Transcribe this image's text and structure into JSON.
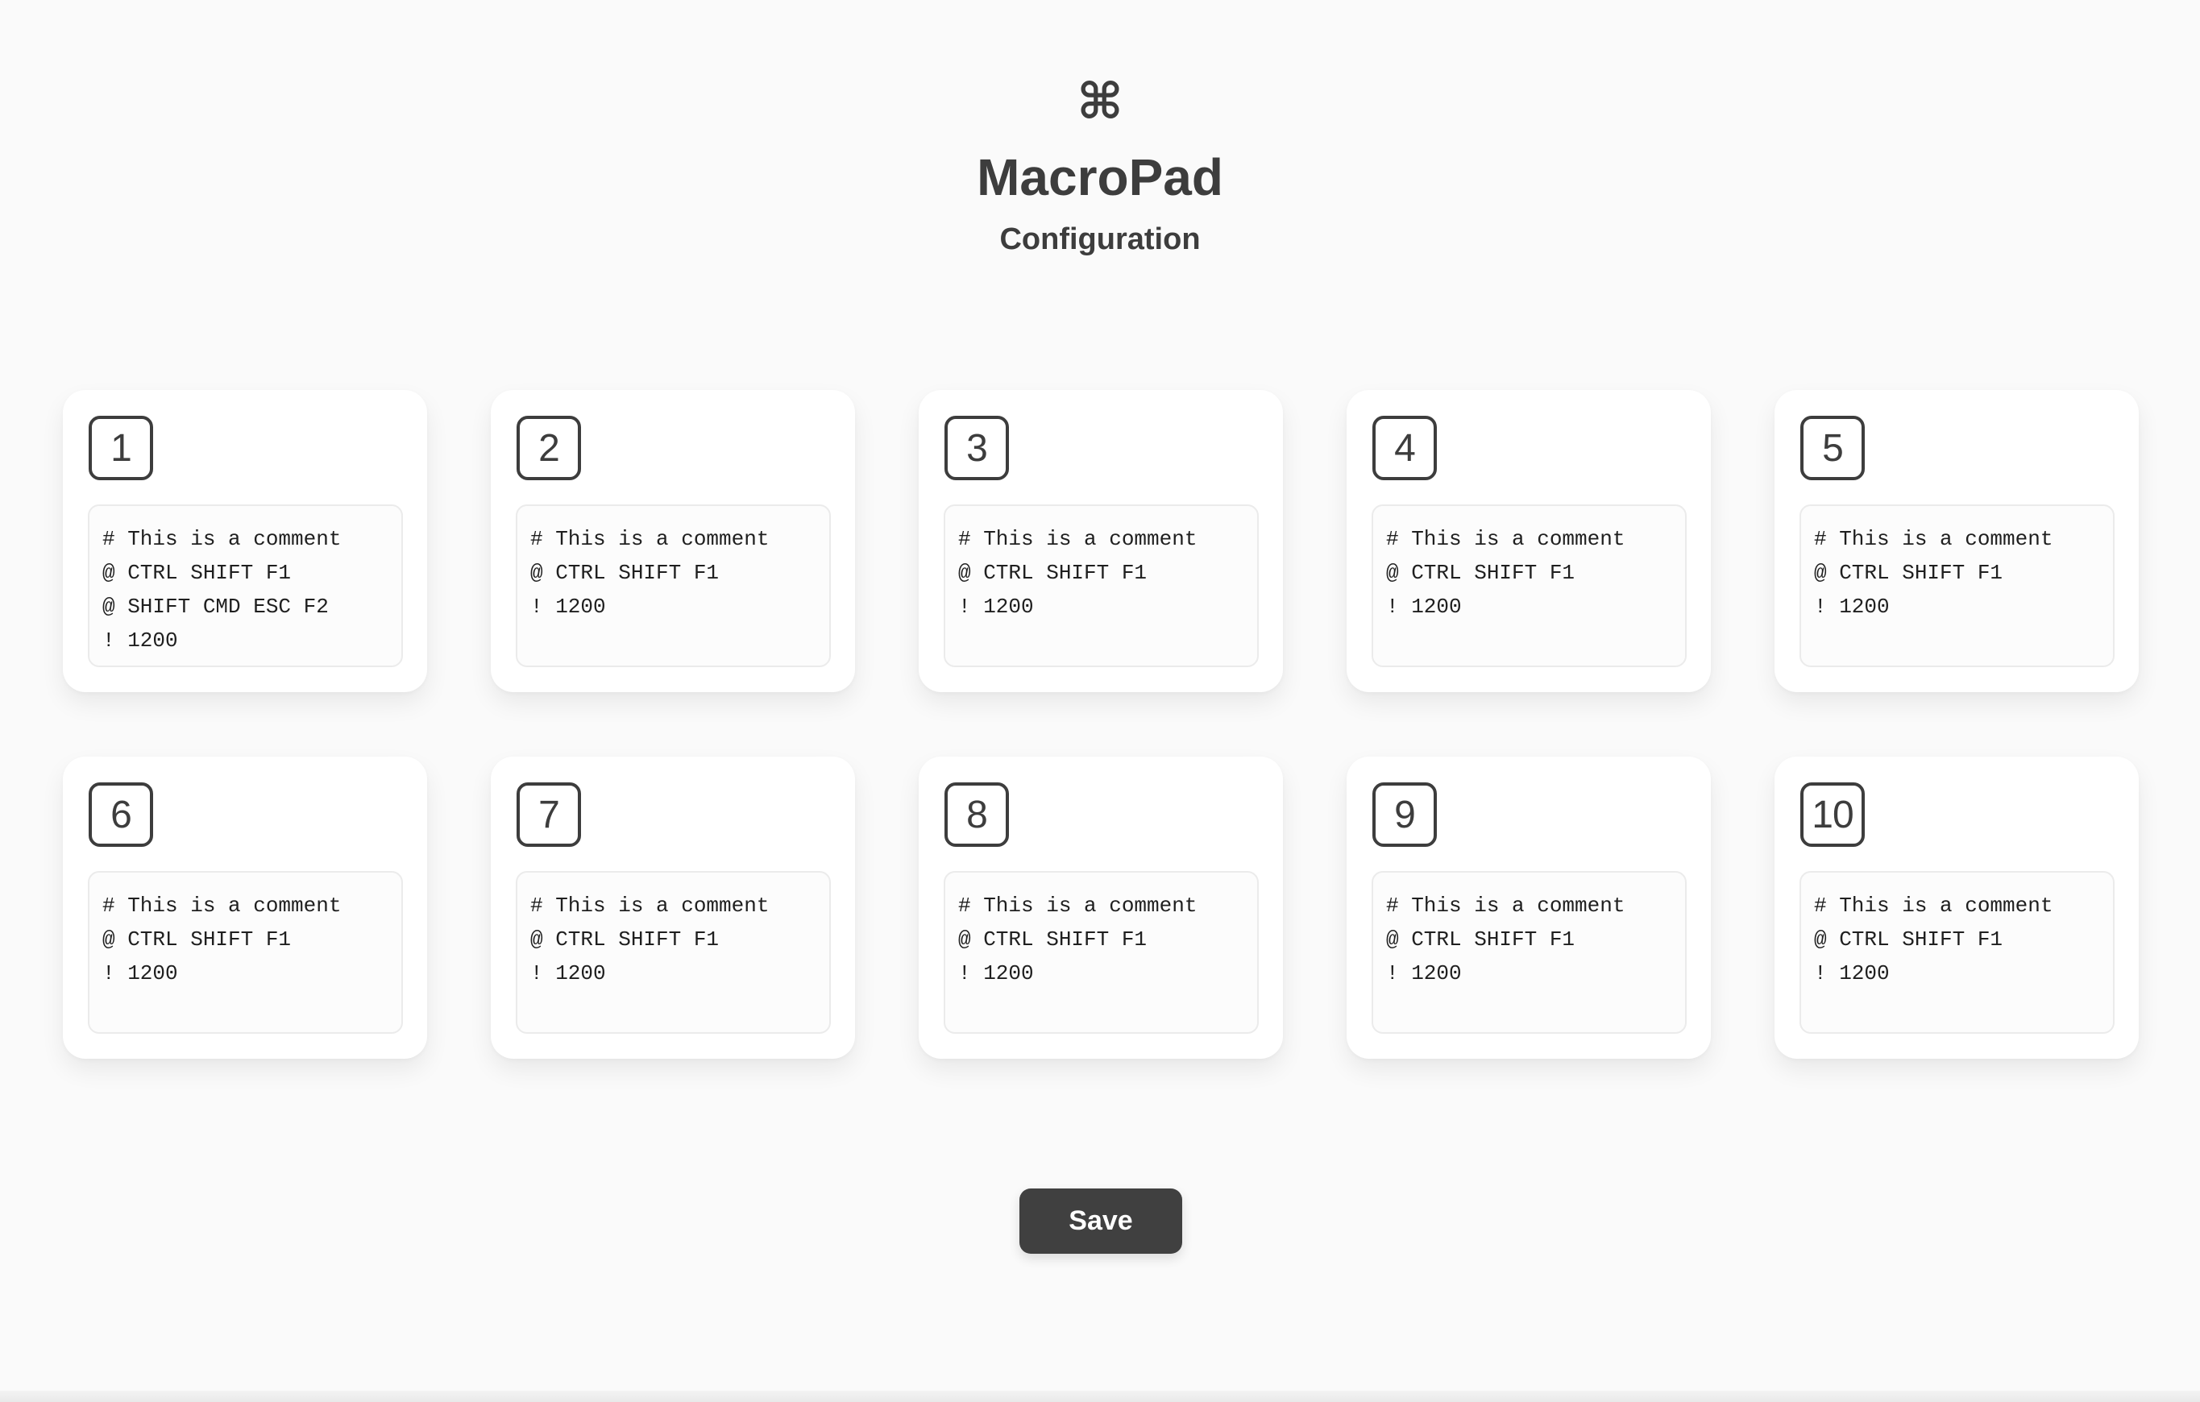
{
  "header": {
    "icon": "⌘",
    "icon_name": "command-icon",
    "title": "MacroPad",
    "subtitle": "Configuration"
  },
  "keys": [
    {
      "number": "1",
      "macro": "# This is a comment\n@ CTRL SHIFT F1\n@ SHIFT CMD ESC F2\n! 1200"
    },
    {
      "number": "2",
      "macro": "# This is a comment\n@ CTRL SHIFT F1\n! 1200"
    },
    {
      "number": "3",
      "macro": "# This is a comment\n@ CTRL SHIFT F1\n! 1200"
    },
    {
      "number": "4",
      "macro": "# This is a comment\n@ CTRL SHIFT F1\n! 1200"
    },
    {
      "number": "5",
      "macro": "# This is a comment\n@ CTRL SHIFT F1\n! 1200"
    },
    {
      "number": "6",
      "macro": "# This is a comment\n@ CTRL SHIFT F1\n! 1200"
    },
    {
      "number": "7",
      "macro": "# This is a comment\n@ CTRL SHIFT F1\n! 1200"
    },
    {
      "number": "8",
      "macro": "# This is a comment\n@ CTRL SHIFT F1\n! 1200"
    },
    {
      "number": "9",
      "macro": "# This is a comment\n@ CTRL SHIFT F1\n! 1200"
    },
    {
      "number": "10",
      "macro": "# This is a comment\n@ CTRL SHIFT F1\n! 1200"
    }
  ],
  "actions": {
    "save_label": "Save"
  },
  "colors": {
    "background": "#fafafa",
    "text": "#3d3d3d",
    "button": "#404040",
    "card": "#ffffff"
  }
}
